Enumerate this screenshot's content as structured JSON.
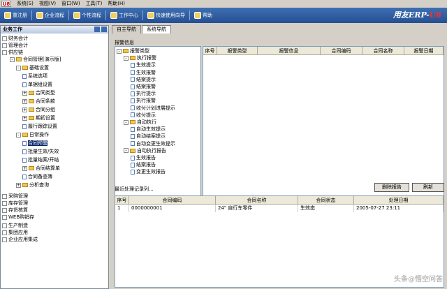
{
  "menu": {
    "logo": "U8",
    "items": [
      "系统(S)",
      "视图(V)",
      "窗口(W)",
      "工具(T)",
      "帮助(H)"
    ]
  },
  "toolbar": {
    "buttons": [
      "重注册",
      "企业流程",
      "个性流程",
      "工作中心",
      "快速使用向导",
      "帮助"
    ],
    "brand": "用友ERP-",
    "brand_suffix": "U8"
  },
  "left": {
    "title": "业务工作",
    "categories_top": [
      "财务会计",
      "管理会计",
      "供应链"
    ],
    "tree": [
      {
        "label": "合同管理[演示版]"
      },
      {
        "label": "基础设置"
      },
      {
        "label": "系统选项"
      },
      {
        "label": "单据组设置"
      },
      {
        "label": "合同类型"
      },
      {
        "label": "合同条款"
      },
      {
        "label": "合同分组"
      },
      {
        "label": "期初设置"
      },
      {
        "label": "履行跟踪设置"
      },
      {
        "label": "日常操作"
      },
      {
        "label": "合同预警"
      },
      {
        "label": "批量生效/失效"
      },
      {
        "label": "批量结案/开结"
      },
      {
        "label": "合同结算单"
      },
      {
        "label": "合同备查簿"
      },
      {
        "label": "分析查询"
      }
    ],
    "categories_mid": [
      "采购管理",
      "库存管理",
      "存货核算",
      "WEB购销存"
    ],
    "categories_bottom": [
      "生产制造",
      "集团应用",
      "企业应用集成"
    ]
  },
  "tabs": [
    "自主导航",
    "系统导航"
  ],
  "alarm": {
    "label": "报警信息",
    "tree": [
      {
        "label": "报警类型",
        "level": 0,
        "kind": "folder"
      },
      {
        "label": "执行报警",
        "level": 1,
        "kind": "folder"
      },
      {
        "label": "生效提示",
        "level": 2,
        "kind": "page"
      },
      {
        "label": "生效报警",
        "level": 2,
        "kind": "page"
      },
      {
        "label": "结案提示",
        "level": 2,
        "kind": "page"
      },
      {
        "label": "结案报警",
        "level": 2,
        "kind": "page"
      },
      {
        "label": "执行提示",
        "level": 2,
        "kind": "page"
      },
      {
        "label": "执行报警",
        "level": 2,
        "kind": "page"
      },
      {
        "label": "收付计划进展提示",
        "level": 2,
        "kind": "page"
      },
      {
        "label": "收付提示",
        "level": 2,
        "kind": "page"
      },
      {
        "label": "自动执行",
        "level": 1,
        "kind": "folder"
      },
      {
        "label": "自动生效提示",
        "level": 2,
        "kind": "page"
      },
      {
        "label": "自动结案提示",
        "level": 2,
        "kind": "page"
      },
      {
        "label": "自动变更生效提示",
        "level": 2,
        "kind": "page"
      },
      {
        "label": "自动执行报告",
        "level": 1,
        "kind": "folder"
      },
      {
        "label": "生效报告",
        "level": 2,
        "kind": "page"
      },
      {
        "label": "结案报告",
        "level": 2,
        "kind": "page"
      },
      {
        "label": "变更生效报告",
        "level": 2,
        "kind": "page"
      }
    ],
    "columns": [
      "序号",
      "报警类型",
      "报警信息",
      "合同编码",
      "合同名称",
      "报警日期"
    ]
  },
  "records": {
    "label": "最近处理记录列...",
    "delete_button": "删除报告",
    "refresh_button": "刷新",
    "columns": [
      "序号",
      "合同编码",
      "合同名称",
      "合同状态",
      "处理日期"
    ],
    "rows": [
      [
        "1",
        "0000000001",
        "24\" 自行车零件",
        "生效态",
        "2005-07-27 23:11"
      ]
    ]
  },
  "watermark": "头条@悟空问答"
}
